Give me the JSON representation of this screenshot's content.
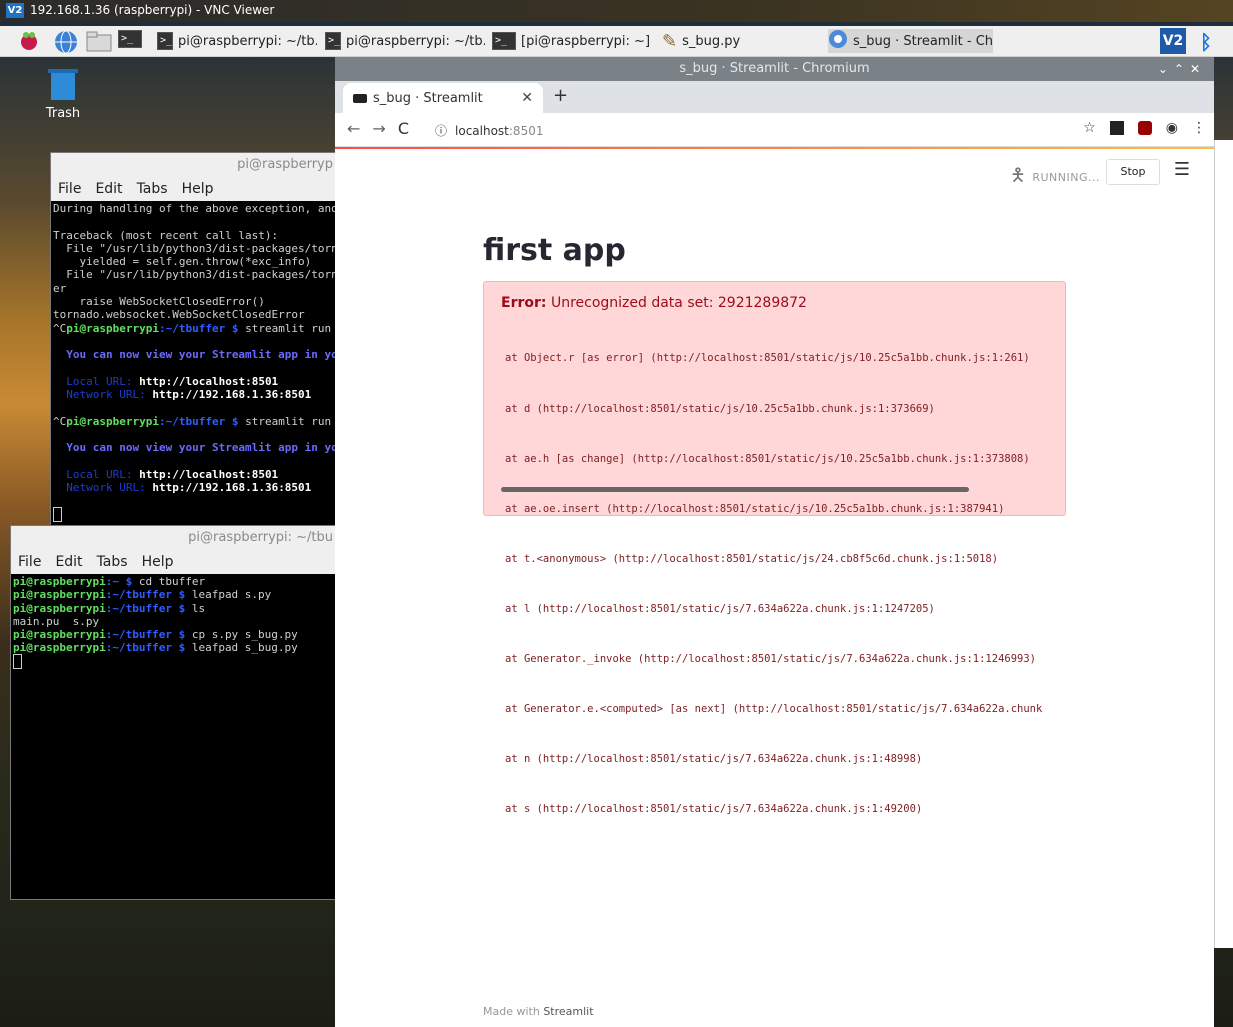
{
  "vnc": {
    "title": "192.168.1.36 (raspberrypi) - VNC Viewer",
    "logo": "V2"
  },
  "taskbar": {
    "tasks": [
      {
        "label": "pi@raspberrypi: ~/tb...",
        "icon": "terminal-icon"
      },
      {
        "label": "pi@raspberrypi: ~/tb...",
        "icon": "terminal-icon"
      },
      {
        "label": "[pi@raspberrypi: ~]",
        "icon": "terminal-icon"
      },
      {
        "label": "s_bug.py",
        "icon": "pencil-icon"
      },
      {
        "label": "s_bug · Streamlit - Ch...",
        "icon": "chromium-icon"
      }
    ],
    "vnc_icon": "V2",
    "bluetooth_icon": "bluetooth-icon"
  },
  "desktop": {
    "trash_label": "Trash"
  },
  "terminal1": {
    "title": "pi@raspberryp",
    "menu": [
      "File",
      "Edit",
      "Tabs",
      "Help"
    ]
  },
  "terminal2": {
    "title": "pi@raspberrypi: ~/tbu",
    "menu": [
      "File",
      "Edit",
      "Tabs",
      "Help"
    ]
  },
  "chromium": {
    "window_title": "s_bug · Streamlit - Chromium",
    "tab_title": "s_bug · Streamlit",
    "url_host": "localhost",
    "url_port": ":8501"
  },
  "streamlit": {
    "status": "RUNNING...",
    "stop_label": "Stop",
    "title": "first app",
    "error_label": "Error:",
    "error_message": "Unrecognized data set: 2921289872",
    "stack": [
      "at Object.r [as error] (http://localhost:8501/static/js/10.25c5a1bb.chunk.js:1:261)",
      "at d (http://localhost:8501/static/js/10.25c5a1bb.chunk.js:1:373669)",
      "at ae.h [as change] (http://localhost:8501/static/js/10.25c5a1bb.chunk.js:1:373808)",
      "at ae.oe.insert (http://localhost:8501/static/js/10.25c5a1bb.chunk.js:1:387941)",
      "at t.<anonymous> (http://localhost:8501/static/js/24.cb8f5c6d.chunk.js:1:5018)",
      "at l (http://localhost:8501/static/js/7.634a622a.chunk.js:1:1247205)",
      "at Generator._invoke (http://localhost:8501/static/js/7.634a622a.chunk.js:1:1246993)",
      "at Generator.e.<computed> [as next] (http://localhost:8501/static/js/7.634a622a.chunk",
      "at n (http://localhost:8501/static/js/7.634a622a.chunk.js:1:48998)",
      "at s (http://localhost:8501/static/js/7.634a622a.chunk.js:1:49200)"
    ],
    "footer_prefix": "Made with",
    "footer_link": "Streamlit"
  }
}
